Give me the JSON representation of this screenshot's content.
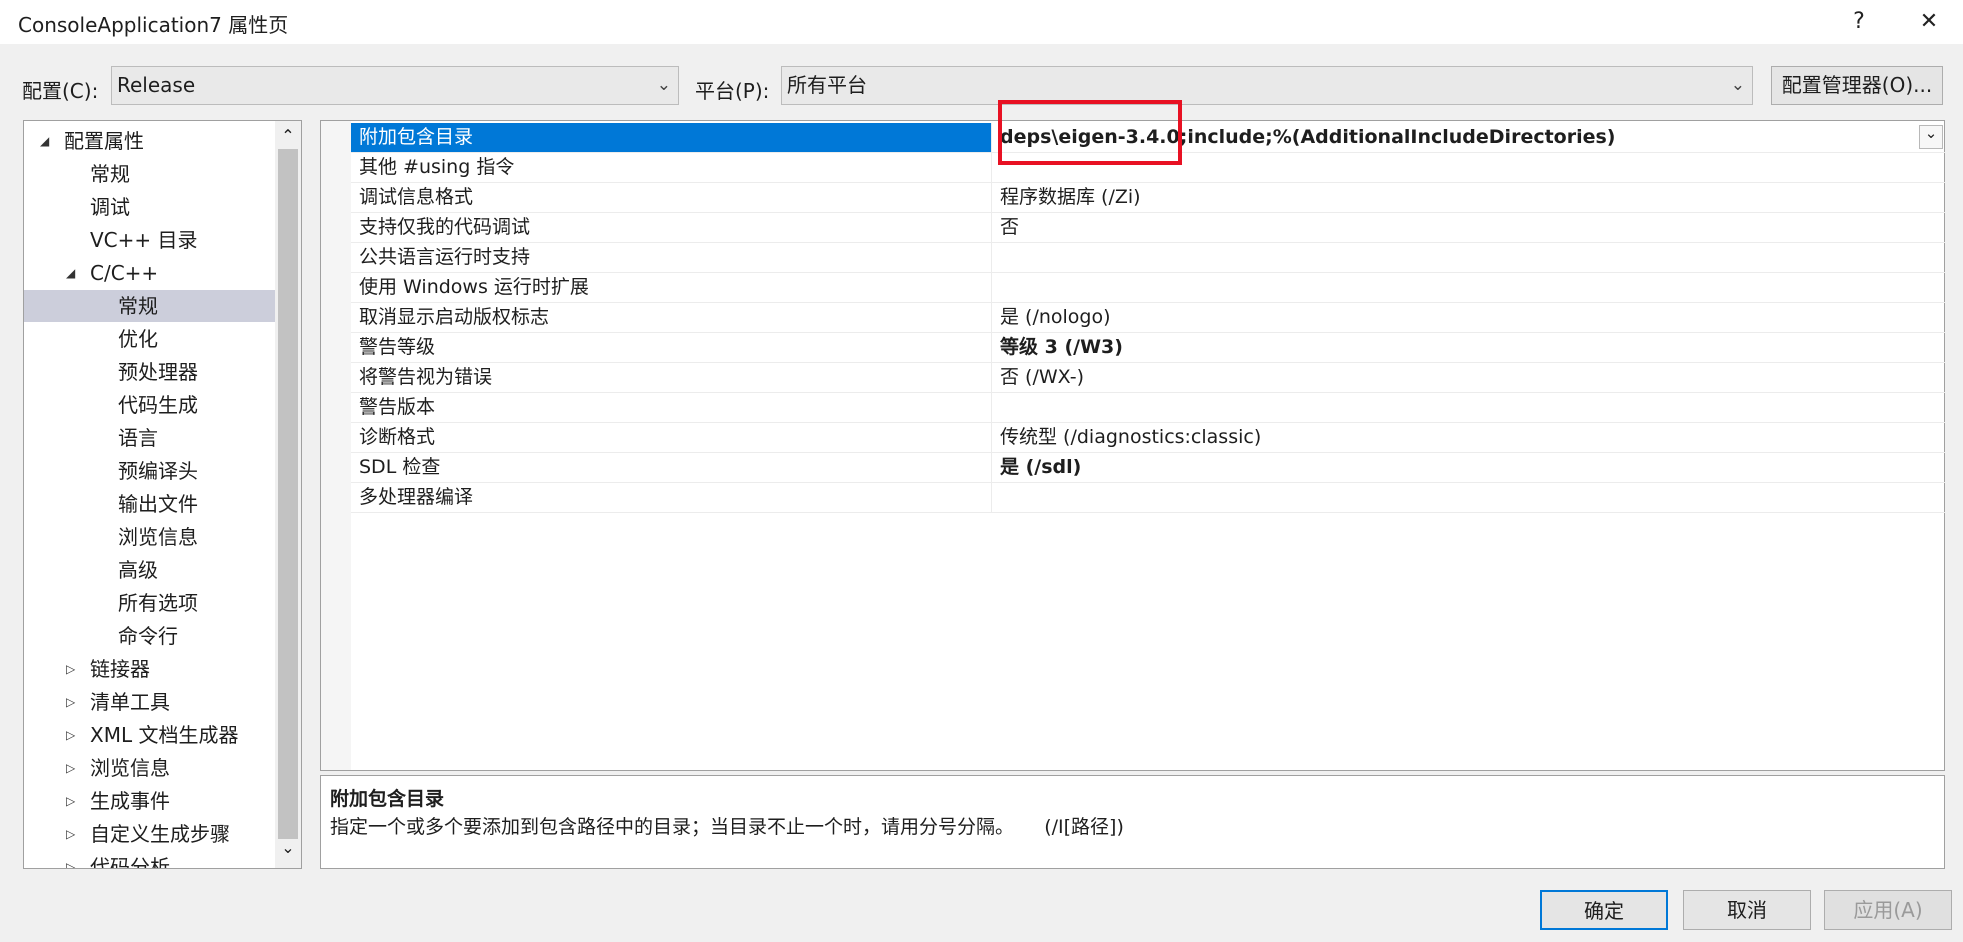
{
  "window": {
    "title": "ConsoleApplication7 属性页",
    "help": "?",
    "close": "✕"
  },
  "toolbar": {
    "config_label": "配置(C):",
    "config_value": "Release",
    "platform_label": "平台(P):",
    "platform_value": "所有平台",
    "config_manager": "配置管理器(O)..."
  },
  "tree": {
    "items": [
      {
        "label": "配置属性",
        "arrow": "◢"
      },
      {
        "label": "常规"
      },
      {
        "label": "调试"
      },
      {
        "label": "VC++ 目录"
      },
      {
        "label": "C/C++",
        "arrow": "◢"
      },
      {
        "label": "常规"
      },
      {
        "label": "优化"
      },
      {
        "label": "预处理器"
      },
      {
        "label": "代码生成"
      },
      {
        "label": "语言"
      },
      {
        "label": "预编译头"
      },
      {
        "label": "输出文件"
      },
      {
        "label": "浏览信息"
      },
      {
        "label": "高级"
      },
      {
        "label": "所有选项"
      },
      {
        "label": "命令行"
      },
      {
        "label": "链接器",
        "arrow": "▷"
      },
      {
        "label": "清单工具",
        "arrow": "▷"
      },
      {
        "label": "XML 文档生成器",
        "arrow": "▷"
      },
      {
        "label": "浏览信息",
        "arrow": "▷"
      },
      {
        "label": "生成事件",
        "arrow": "▷"
      },
      {
        "label": "自定义生成步骤",
        "arrow": "▷"
      },
      {
        "label": "代码分析",
        "arrow": "▷"
      }
    ],
    "scroll_up": "⌃",
    "scroll_down": "⌄"
  },
  "grid": {
    "rows": [
      {
        "name": "附加包含目录",
        "value": "deps\\eigen-3.4.0;include;%(AdditionalIncludeDirectories)"
      },
      {
        "name": "其他 #using 指令",
        "value": ""
      },
      {
        "name": "调试信息格式",
        "value": "程序数据库 (/Zi)"
      },
      {
        "name": "支持仅我的代码调试",
        "value": "否"
      },
      {
        "name": "公共语言运行时支持",
        "value": ""
      },
      {
        "name": "使用 Windows 运行时扩展",
        "value": ""
      },
      {
        "name": "取消显示启动版权标志",
        "value": "是 (/nologo)"
      },
      {
        "name": "警告等级",
        "value": "等级 3 (/W3)"
      },
      {
        "name": "将警告视为错误",
        "value": "否 (/WX-)"
      },
      {
        "name": "警告版本",
        "value": ""
      },
      {
        "name": "诊断格式",
        "value": "传统型 (/diagnostics:classic)"
      },
      {
        "name": "SDL 检查",
        "value": "是 (/sdl)"
      },
      {
        "name": "多处理器编译",
        "value": ""
      }
    ],
    "dropdown": "⌄"
  },
  "description": {
    "title": "附加包含目录",
    "text": "指定一个或多个要添加到包含路径中的目录；当目录不止一个时，请用分号分隔。     (/I[路径])"
  },
  "buttons": {
    "ok": "确定",
    "cancel": "取消",
    "apply": "应用(A)"
  },
  "colors": {
    "selection": "#0078d7",
    "tree_selection": "#cccedb",
    "highlight_box": "#e81123"
  }
}
